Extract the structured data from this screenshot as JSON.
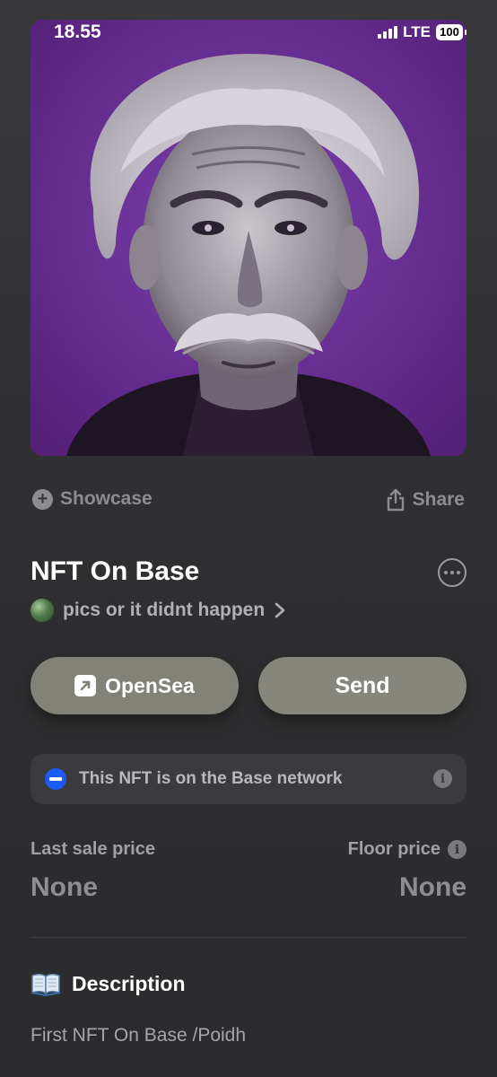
{
  "status_bar": {
    "time": "18.55",
    "network": "LTE",
    "battery": "100"
  },
  "nft_image": {
    "subject": "portrait-of-gray-haired-man-with-mustache",
    "background_color": "#6a2e97"
  },
  "actions": {
    "showcase_label": "Showcase",
    "share_label": "Share"
  },
  "title": "NFT On Base",
  "collection": {
    "name": "pics or it didnt happen"
  },
  "buttons": {
    "opensea_label": "OpenSea",
    "send_label": "Send"
  },
  "network_banner": {
    "text": "This NFT is on the Base network",
    "icon": "base-network-icon"
  },
  "prices": {
    "last_sale_label": "Last sale price",
    "last_sale_value": "None",
    "floor_label": "Floor price",
    "floor_value": "None"
  },
  "description": {
    "heading": "Description",
    "text": "First NFT On Base /Poidh"
  },
  "colors": {
    "background": "#2f2f31",
    "button": "#828278",
    "base_blue": "#1d5bf5"
  }
}
